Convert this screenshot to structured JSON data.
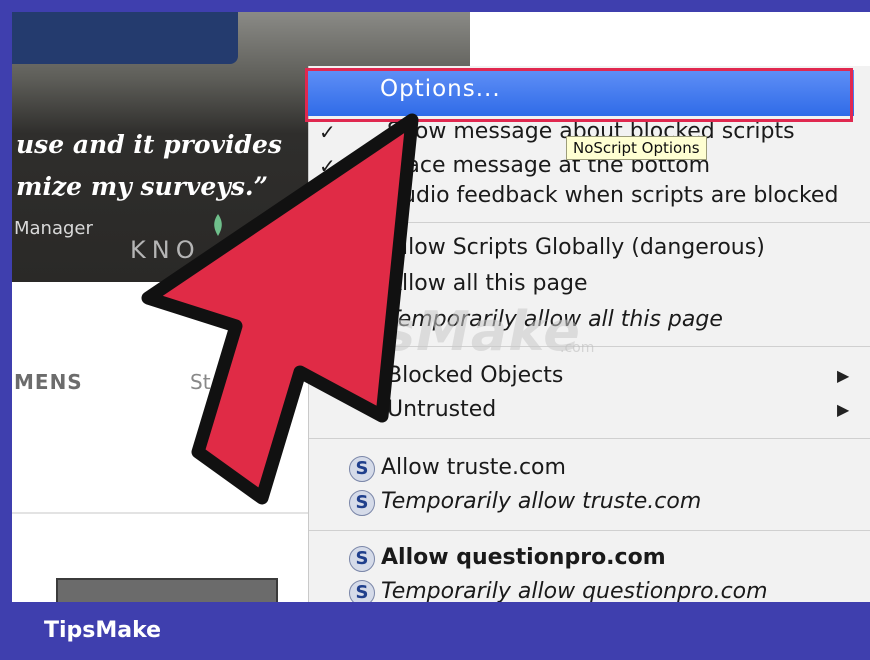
{
  "background_page": {
    "quote_line1": "use and it provides",
    "quote_line2": "mize my surveys.”",
    "byline": "Manager",
    "logo_fragment": "KNO",
    "nav_item": "MENS",
    "nav_item2": "St"
  },
  "menu": {
    "options_label": "Options...",
    "tooltip": "NoScript Options",
    "items": [
      {
        "check": "✓",
        "label": "Show message about blocked scripts"
      },
      {
        "check": "✓",
        "label": "Place message at the bottom"
      },
      {
        "check": "",
        "label": "Audio feedback when scripts are blocked"
      },
      {
        "label": "Allow Scripts Globally (dangerous)"
      },
      {
        "label": "Allow all this page"
      },
      {
        "label": "Temporarily allow all this page"
      },
      {
        "label": "Blocked Objects",
        "submenu_arrow": "▶"
      },
      {
        "label": "Untrusted",
        "submenu_arrow": "▶"
      },
      {
        "icon": "S",
        "label": "Allow truste.com"
      },
      {
        "icon": "S",
        "label": "Temporarily allow truste.com"
      },
      {
        "icon": "S",
        "label": "Allow questionpro.com"
      },
      {
        "icon": "S",
        "label": "Temporarily allow questionpro.com"
      }
    ]
  },
  "watermark": {
    "text": "TipsMake",
    "suffix": ".com"
  },
  "footer": {
    "brand": "TipsMake"
  },
  "colors": {
    "frame": "#3f3fae",
    "menu_highlight": "#2f6be8",
    "highlight_box": "#e0284f",
    "arrow_fill": "#e02b46"
  }
}
